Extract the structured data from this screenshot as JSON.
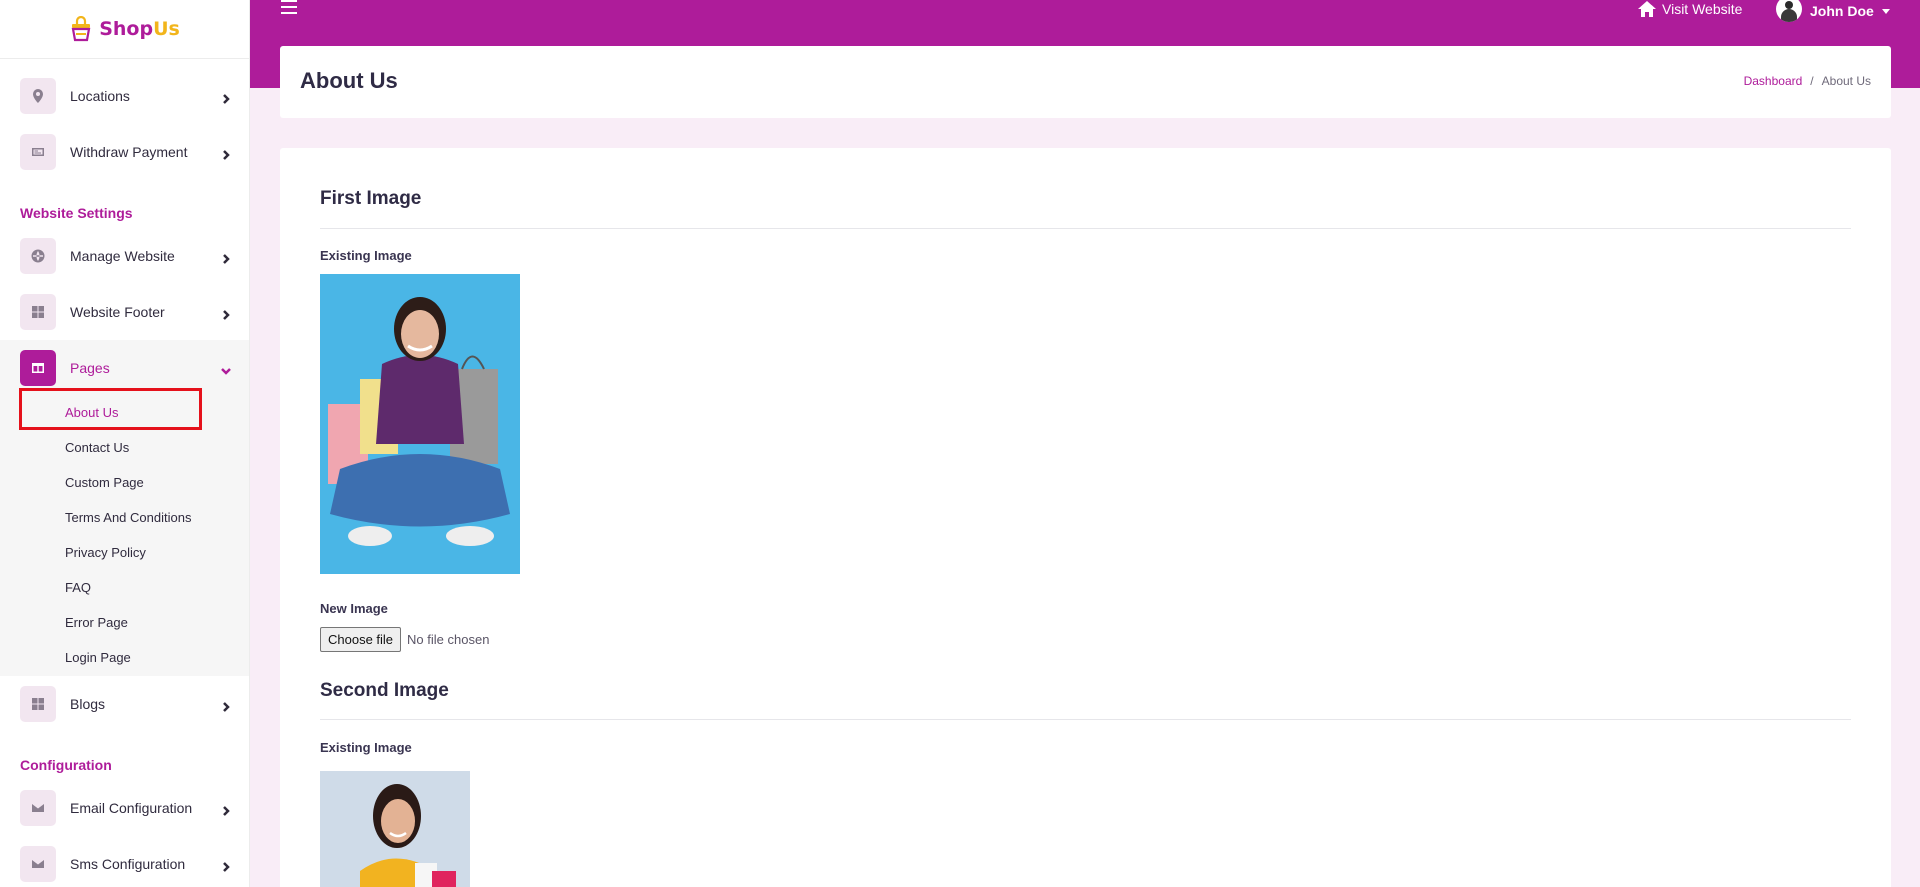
{
  "brand": {
    "name_main": "Shop",
    "name_accent": "Us"
  },
  "topbar": {
    "visit_label": "Visit Website",
    "user_name": "John Doe"
  },
  "colors": {
    "primary": "#ae1c9a",
    "accent": "#f2b51b",
    "highlight": "#e5111b"
  },
  "sidebar": {
    "items_top": [
      {
        "label": "Locations",
        "icon": "map-pin-icon"
      },
      {
        "label": "Withdraw Payment",
        "icon": "payment-card-icon"
      }
    ],
    "section_website": "Website Settings",
    "items_website": [
      {
        "label": "Manage Website",
        "icon": "globe-icon"
      },
      {
        "label": "Website Footer",
        "icon": "grid-icon"
      },
      {
        "label": "Pages",
        "icon": "columns-icon"
      }
    ],
    "pages_submenu": [
      "About Us",
      "Contact Us",
      "Custom Page",
      "Terms And Conditions",
      "Privacy Policy",
      "FAQ",
      "Error Page",
      "Login Page"
    ],
    "items_blog": [
      {
        "label": "Blogs",
        "icon": "grid-icon"
      }
    ],
    "section_config": "Configuration",
    "items_config": [
      {
        "label": "Email Configuration",
        "icon": "envelope-icon"
      },
      {
        "label": "Sms Configuration",
        "icon": "envelope-icon"
      }
    ]
  },
  "header": {
    "title": "About Us",
    "breadcrumb_link": "Dashboard",
    "breadcrumb_sep": "/",
    "breadcrumb_current": "About Us"
  },
  "main": {
    "first": {
      "title": "First Image",
      "existing_label": "Existing Image",
      "new_label": "New Image",
      "choose_btn": "Choose file",
      "file_status": "No file chosen"
    },
    "second": {
      "title": "Second Image",
      "existing_label": "Existing Image"
    }
  }
}
